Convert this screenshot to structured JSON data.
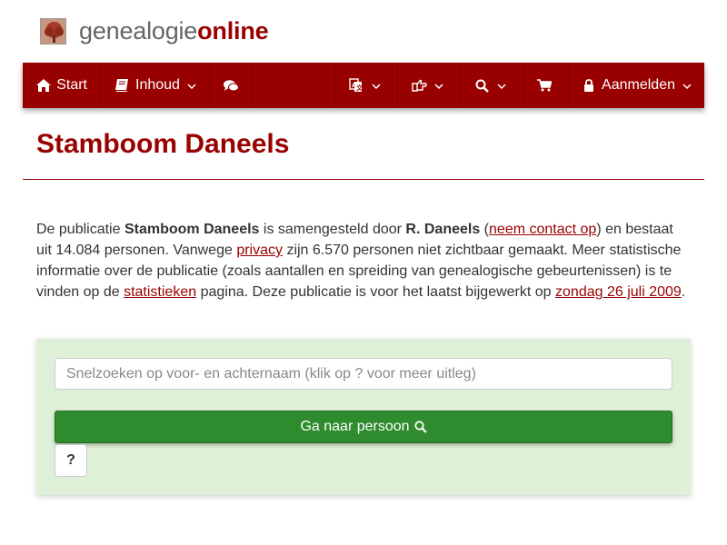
{
  "logo": {
    "part1": "genealogie",
    "part2": "online",
    "icon": "tree-icon"
  },
  "nav": {
    "start": {
      "label": "Start",
      "icon": "home-icon"
    },
    "inhoud": {
      "label": "Inhoud",
      "icon": "book-icon"
    },
    "chat": {
      "icon": "comments-icon"
    },
    "language": {
      "icon": "translate-icon"
    },
    "share": {
      "icon": "share-icon"
    },
    "search": {
      "icon": "search-icon"
    },
    "cart": {
      "icon": "cart-icon"
    },
    "login": {
      "label": "Aanmelden",
      "icon": "lock-icon"
    }
  },
  "page_title": "Stamboom Daneels",
  "intro": {
    "t1": "De publicatie ",
    "pub_name": "Stamboom Daneels",
    "t2": " is samengesteld door ",
    "author": "R. Daneels",
    "t3": " (",
    "contact_link": "neem contact op",
    "t4": ") en bestaat uit 14.084 personen. Vanwege ",
    "privacy_link": "privacy",
    "t5": " zijn 6.570 personen niet zichtbaar gemaakt. Meer statistische informatie over de publicatie (zoals aantallen en spreiding van genealogische gebeurtenissen) is te vinden op de ",
    "stats_link": "statistieken",
    "t6": " pagina. Deze publicatie is voor het laatst bijgewerkt op ",
    "date_link": "zondag 26 juli 2009",
    "t7": "."
  },
  "search": {
    "placeholder": "Snelzoeken op voor- en achternaam (klik op ? voor meer uitleg)",
    "button_label": "Ga naar persoon",
    "help_label": "?"
  },
  "colors": {
    "brand": "#990000",
    "panel": "#dff0d8",
    "button": "#2e8b2e"
  }
}
